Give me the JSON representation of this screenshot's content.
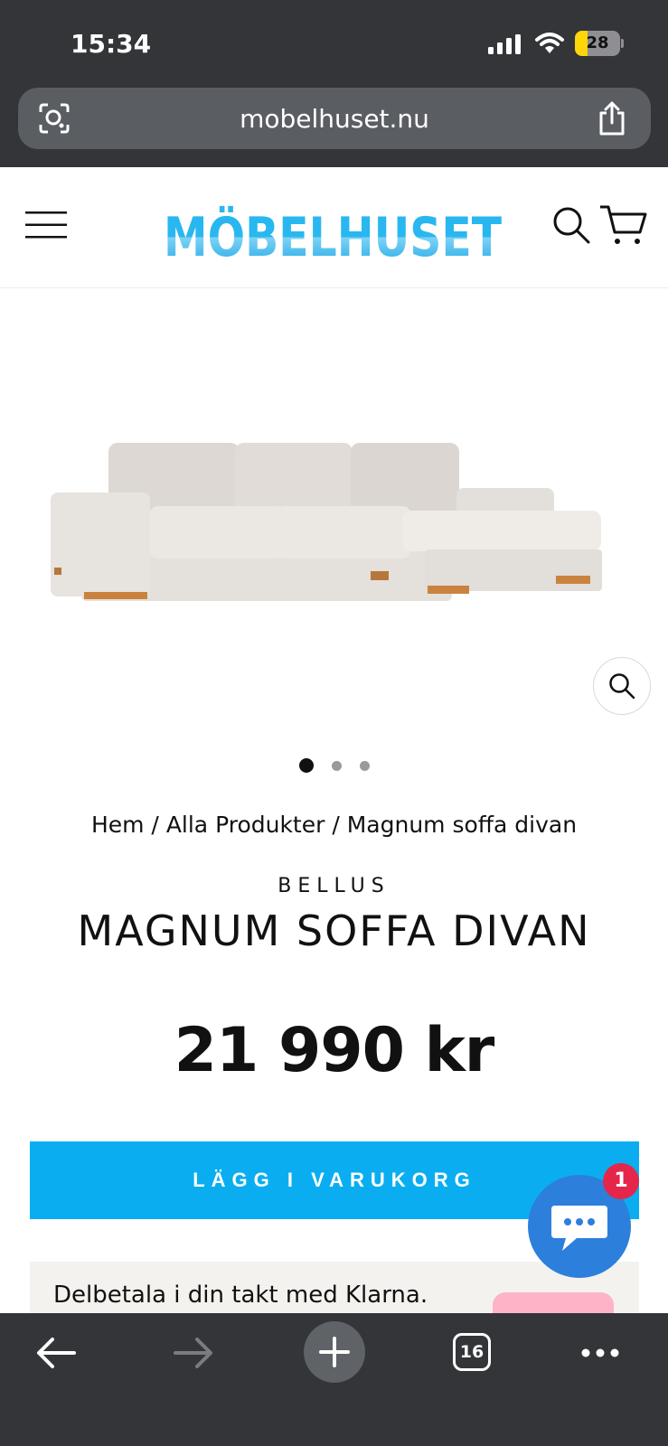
{
  "status_bar": {
    "time": "15:34",
    "battery_level": "28"
  },
  "browser": {
    "url": "mobelhuset.nu",
    "tab_count": "16"
  },
  "site": {
    "logo_text": "MÖBELHUSET"
  },
  "gallery": {
    "image_count": 3,
    "active_index": 0
  },
  "breadcrumb": {
    "home": "Hem",
    "category": "Alla Produkter",
    "current": "Magnum soffa divan",
    "separator": " / "
  },
  "product": {
    "vendor": "BELLUS",
    "title": "MAGNUM SOFFA DIVAN",
    "price": "21 990 kr",
    "add_to_cart_label": "LÄGG I VARUKORG"
  },
  "klarna": {
    "text": "Delbetala i din takt med Klarna."
  },
  "chat": {
    "badge_count": "1"
  },
  "colors": {
    "accent": "#0aaef0",
    "chat": "#2d7fdc",
    "badge": "#e5264a",
    "browser_chrome": "#333538",
    "klarna_pink": "#ffb3c7"
  }
}
